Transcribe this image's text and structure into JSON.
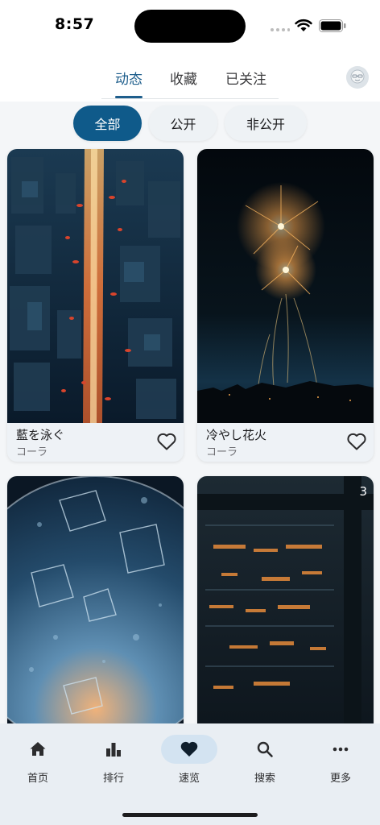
{
  "status_bar": {
    "time": "8:57"
  },
  "tabs": [
    {
      "label": "动态",
      "active": true
    },
    {
      "label": "收藏",
      "active": false
    },
    {
      "label": "已关注",
      "active": false
    }
  ],
  "filters": [
    {
      "label": "全部",
      "active": true
    },
    {
      "label": "公开",
      "active": false
    },
    {
      "label": "非公开",
      "active": false
    }
  ],
  "cards": [
    {
      "title": "藍を泳ぐ",
      "author": "コーラ",
      "image": "city-fish-artwork"
    },
    {
      "title": "冷やし花火",
      "author": "コーラ",
      "image": "fireworks-artwork"
    },
    {
      "title": "",
      "author": "",
      "image": "ice-cubes-sky-artwork"
    },
    {
      "title": "",
      "author": "",
      "image": "night-city-window-artwork",
      "badge": "3"
    }
  ],
  "bottom_nav": [
    {
      "label": "首页",
      "icon": "home-icon",
      "active": false
    },
    {
      "label": "排行",
      "icon": "ranking-icon",
      "active": false
    },
    {
      "label": "速览",
      "icon": "heart-icon",
      "active": true
    },
    {
      "label": "搜索",
      "icon": "search-icon",
      "active": false
    },
    {
      "label": "更多",
      "icon": "more-icon",
      "active": false
    }
  ],
  "colors": {
    "accent": "#0f5a8a",
    "tab_active": "#1e5e8c",
    "nav_pill": "#d3e3f1"
  }
}
